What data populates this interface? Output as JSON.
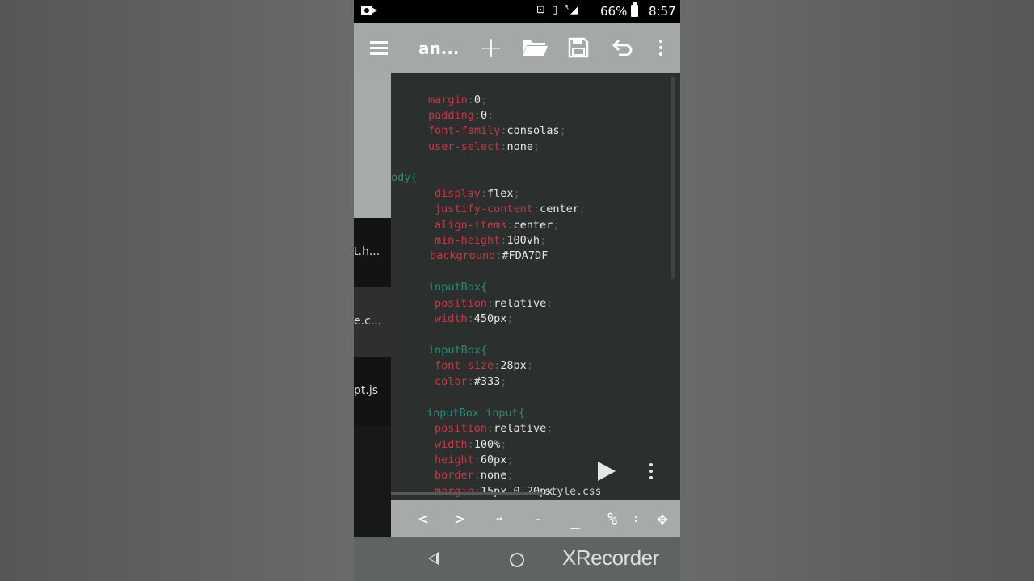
{
  "status_bar": {
    "icons": "⊡ ▯ ᴿ◢",
    "battery": "66%",
    "time": "8:57"
  },
  "toolbar": {
    "title": "an...",
    "add": "+",
    "undo": "↶"
  },
  "file_panel": {
    "files": [
      "t.h...",
      "e.c...",
      "pt.js"
    ]
  },
  "code": [
    [
      {
        "t": "margin",
        "c": "prop"
      },
      {
        "t": ":",
        "c": "punc"
      },
      {
        "t": "0",
        "c": "val"
      },
      {
        "t": ";",
        "c": "punc"
      }
    ],
    [
      {
        "t": "padding",
        "c": "prop"
      },
      {
        "t": ":",
        "c": "punc"
      },
      {
        "t": "0",
        "c": "val"
      },
      {
        "t": ";",
        "c": "punc"
      }
    ],
    [
      {
        "t": "font-family",
        "c": "prop"
      },
      {
        "t": ":",
        "c": "punc"
      },
      {
        "t": "consolas",
        "c": "val"
      },
      {
        "t": ";",
        "c": "punc"
      }
    ],
    [
      {
        "t": "user-select",
        "c": "prop"
      },
      {
        "t": ":",
        "c": "punc"
      },
      {
        "t": "none",
        "c": "val"
      },
      {
        "t": ";",
        "c": "punc"
      }
    ],
    [
      {
        "t": "ody{",
        "c": "sel"
      }
    ],
    [
      {
        "t": "display",
        "c": "prop"
      },
      {
        "t": ":",
        "c": "punc"
      },
      {
        "t": "flex",
        "c": "val"
      },
      {
        "t": ";",
        "c": "punc"
      }
    ],
    [
      {
        "t": "justify-content",
        "c": "prop"
      },
      {
        "t": ":",
        "c": "punc"
      },
      {
        "t": "center",
        "c": "val"
      },
      {
        "t": ";",
        "c": "punc"
      }
    ],
    [
      {
        "t": "align-items",
        "c": "prop"
      },
      {
        "t": ":",
        "c": "punc"
      },
      {
        "t": "center",
        "c": "val"
      },
      {
        "t": ";",
        "c": "punc"
      }
    ],
    [
      {
        "t": "min-height",
        "c": "prop"
      },
      {
        "t": ":",
        "c": "punc"
      },
      {
        "t": "100vh",
        "c": "val"
      },
      {
        "t": ";",
        "c": "punc"
      }
    ],
    [
      {
        "t": "background",
        "c": "prop"
      },
      {
        "t": ":",
        "c": "punc"
      },
      {
        "t": "#FDA7DF",
        "c": "val"
      }
    ],
    [
      {
        "t": "inputBox{",
        "c": "sel"
      }
    ],
    [
      {
        "t": "position",
        "c": "prop"
      },
      {
        "t": ":",
        "c": "punc"
      },
      {
        "t": "relative",
        "c": "val"
      },
      {
        "t": ";",
        "c": "punc"
      }
    ],
    [
      {
        "t": "width",
        "c": "prop"
      },
      {
        "t": ":",
        "c": "punc"
      },
      {
        "t": "450px",
        "c": "val"
      },
      {
        "t": ";",
        "c": "punc"
      }
    ],
    [
      {
        "t": "inputBox{",
        "c": "sel"
      }
    ],
    [
      {
        "t": "font-size",
        "c": "prop"
      },
      {
        "t": ":",
        "c": "punc"
      },
      {
        "t": "28px",
        "c": "val"
      },
      {
        "t": ";",
        "c": "punc"
      }
    ],
    [
      {
        "t": "color",
        "c": "prop"
      },
      {
        "t": ":",
        "c": "punc"
      },
      {
        "t": "#333",
        "c": "val"
      },
      {
        "t": ";",
        "c": "punc"
      }
    ],
    [
      {
        "t": "inputBox input{",
        "c": "sel"
      }
    ],
    [
      {
        "t": "position",
        "c": "prop"
      },
      {
        "t": ":",
        "c": "punc"
      },
      {
        "t": "relative",
        "c": "val"
      },
      {
        "t": ";",
        "c": "punc"
      }
    ],
    [
      {
        "t": "width",
        "c": "prop"
      },
      {
        "t": ":",
        "c": "punc"
      },
      {
        "t": "100%",
        "c": "val"
      },
      {
        "t": ";",
        "c": "punc"
      }
    ],
    [
      {
        "t": "height",
        "c": "prop"
      },
      {
        "t": ":",
        "c": "punc"
      },
      {
        "t": "60px",
        "c": "val"
      },
      {
        "t": ";",
        "c": "punc"
      }
    ],
    [
      {
        "t": "border",
        "c": "prop"
      },
      {
        "t": ":",
        "c": "punc"
      },
      {
        "t": "none",
        "c": "val"
      },
      {
        "t": ";",
        "c": "punc"
      }
    ],
    [
      {
        "t": "margin",
        "c": "prop"
      },
      {
        "t": ":",
        "c": "punc"
      },
      {
        "t": "15px 0 20px",
        "c": "val"
      }
    ]
  ],
  "editor": {
    "tab_label": "style.css"
  },
  "key_bar": {
    "left": "<",
    "right": ">",
    "tab": "→",
    "minus": "-",
    "underscore": "_",
    "percent": "%",
    "colon": ":",
    "move": "✥"
  },
  "nav_bar": {
    "watermark": "XRecorder"
  }
}
